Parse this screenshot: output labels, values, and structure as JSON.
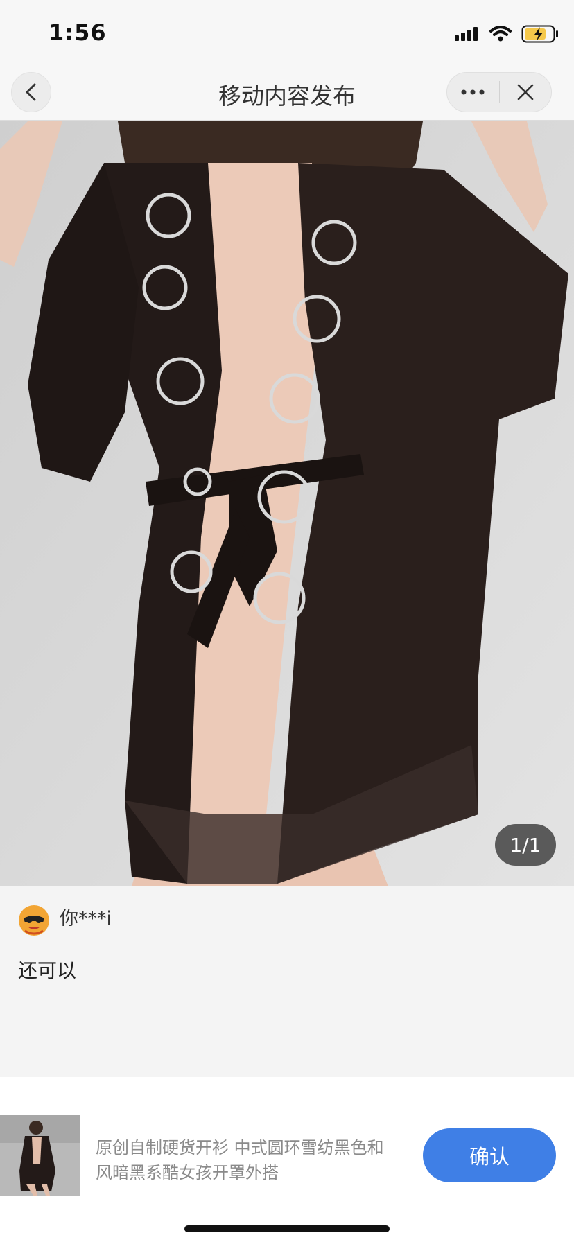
{
  "status_bar": {
    "time": "1:56",
    "icons": [
      "signal-icon",
      "wifi-icon",
      "battery-charging-icon"
    ]
  },
  "nav": {
    "title": "移动内容发布",
    "back_icon": "chevron-left-icon",
    "more_icon": "more-dots-icon",
    "close_icon": "close-icon"
  },
  "gallery": {
    "counter": "1/1"
  },
  "comment": {
    "user_name": "你***i",
    "text": "还可以"
  },
  "product": {
    "title": "原创自制硬货开衫 中式圆环雪纺黑色和风暗黑系酷女孩开罩外搭",
    "confirm_label": "确认"
  },
  "colors": {
    "accent": "#3f7fe6",
    "nav_background": "#f7f7f7",
    "comment_background": "#f4f4f4",
    "battery": "#f5c84a"
  }
}
